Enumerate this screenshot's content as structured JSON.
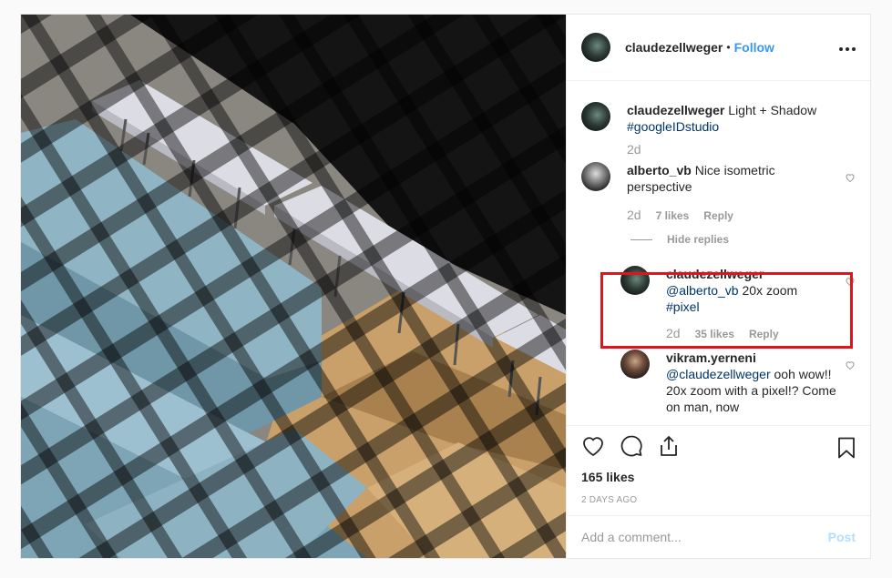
{
  "photo": {
    "alt": ""
  },
  "header": {
    "username": "claudezellweger",
    "separator": "•",
    "follow_label": "Follow",
    "more_icon": "more-horizontal-icon"
  },
  "caption": {
    "username": "claudezellweger",
    "text": "Light + Shadow",
    "hashtag": "#googleIDstudio",
    "age": "2d"
  },
  "comments": [
    {
      "username": "alberto_vb",
      "text": "Nice isometric perspective",
      "age": "2d",
      "likes": "7 likes",
      "reply": "Reply"
    }
  ],
  "hide_replies_label": "Hide replies",
  "replies": [
    {
      "username": "claudezellweger",
      "mention": "@alberto_vb",
      "text": "20x zoom",
      "hashtag": "#pixel",
      "age": "2d",
      "likes": "35 likes",
      "reply": "Reply"
    },
    {
      "username": "vikram.yerneni",
      "mention": "@claudezellweger",
      "text": "ooh wow!! 20x zoom with a pixel!? Come on man, now"
    }
  ],
  "actions": {
    "like_icon": "heart-icon",
    "comment_icon": "comment-icon",
    "share_icon": "share-icon",
    "save_icon": "bookmark-icon"
  },
  "likes_label": "165 likes",
  "date_label": "2 DAYS AGO",
  "add_comment": {
    "placeholder": "Add a comment...",
    "post_label": "Post"
  },
  "colors": {
    "accent": "#3897f0",
    "highlight": "#e0141b",
    "link": "#003569"
  }
}
